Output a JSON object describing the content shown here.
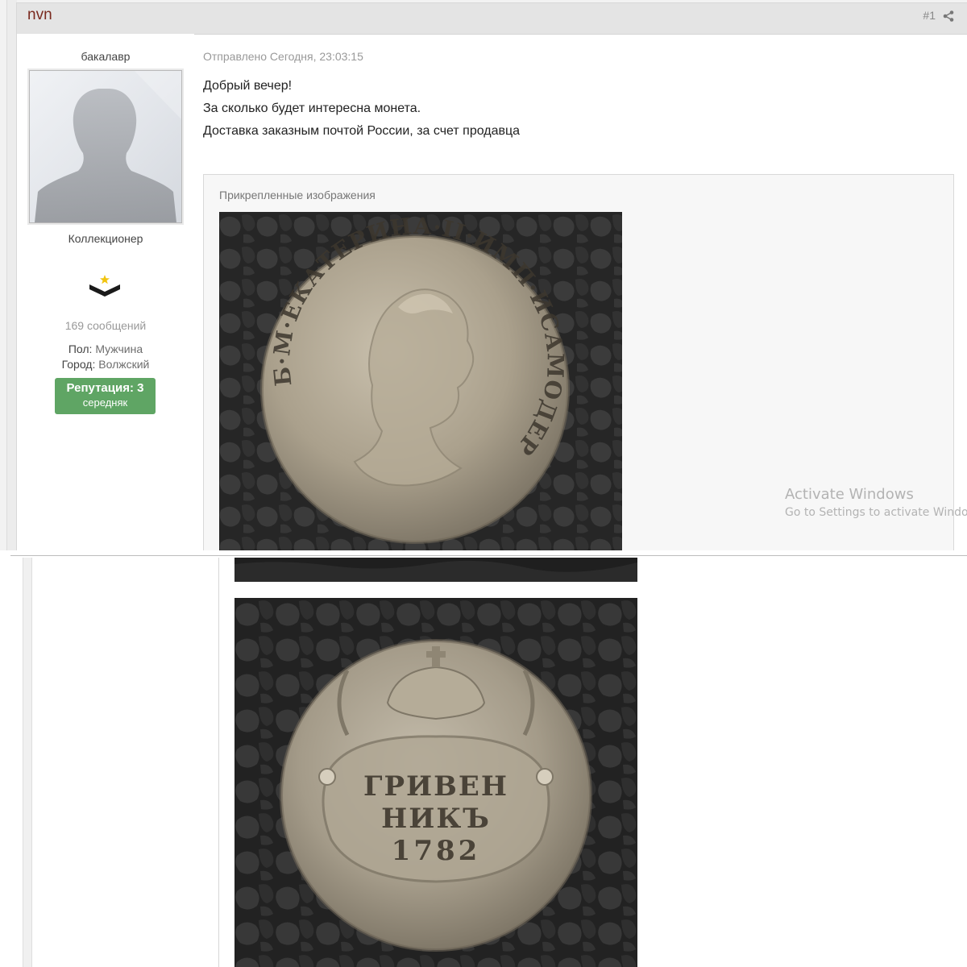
{
  "post": {
    "author": "nvn",
    "number": "#1",
    "date": "Отправлено Сегодня, 23:03:15",
    "body_lines": [
      "Добрый вечер!",
      "За сколько будет интересна монета.",
      "Доставка заказным почтой России, за счет продавца"
    ]
  },
  "user": {
    "title": "бакалавр",
    "rank": "Коллекционер",
    "posts": "169 сообщений",
    "gender_label": "Пол:",
    "gender_value": "Мужчина",
    "city_label": "Город:",
    "city_value": "Волжский",
    "reputation_label": "Репутация: 3",
    "reputation_level": "середняк"
  },
  "attachments": {
    "title": "Прикрепленные изображения",
    "images": [
      {
        "name": "coin-obverse",
        "inscription": "Б·М·ЕКАТЕРИНА·II·ИМП·ИСАМОДЕРЖ·ВСЕРОС·"
      },
      {
        "name": "coin-reverse",
        "inscription": "ГРИВЕН НИКЪ 1782"
      }
    ]
  },
  "watermark": {
    "line1": "Activate Windows",
    "line2": "Go to Settings to activate Windows."
  },
  "colors": {
    "author": "#7a2a1f",
    "reputation_bg": "#5fa564",
    "header_bg": "#e4e4e4"
  }
}
